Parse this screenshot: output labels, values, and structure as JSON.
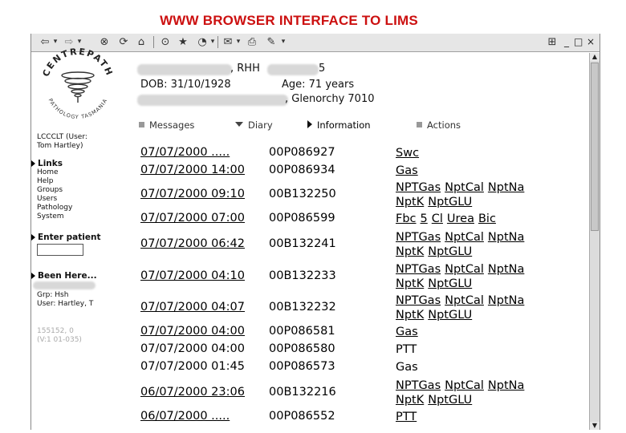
{
  "slide_title": "WWW BROWSER INTERFACE TO LIMS",
  "toolbar": {
    "icons": [
      "back-icon",
      "forward-icon",
      "stop-icon",
      "refresh-icon",
      "home-icon",
      "search-icon",
      "favorites-icon",
      "history-icon",
      "mail-icon",
      "print-icon",
      "edit-icon"
    ]
  },
  "window_controls": [
    "_",
    "□",
    "×"
  ],
  "sidebar": {
    "logo_text": "CENTREPATH",
    "logo_subtext": "PATHOLOGY TASMANIA",
    "user_line1": "LCCCLT (User:",
    "user_line2": "Tom Hartley)",
    "links_heading": "Links",
    "links": [
      "Home",
      "Help",
      "Groups",
      "Users",
      "Pathology",
      "System"
    ],
    "enter_patient_heading": "Enter patient",
    "been_here_heading": "Been Here...",
    "grp_line": "Grp: Hsh",
    "user_line": "User: Hartley, T",
    "footer_line1": "155152, 0",
    "footer_line2": "(V:1 01-035)"
  },
  "patient": {
    "name_suffix": ", RHH",
    "name_tail": "5",
    "dob": "DOB: 31/10/1928",
    "age": "Age: 71 years",
    "address_tail": ", Glenorchy 7010"
  },
  "tabs": [
    {
      "label": "Messages",
      "marker": "square"
    },
    {
      "label": "Diary",
      "marker": "down"
    },
    {
      "label": "Information",
      "marker": "right"
    },
    {
      "label": "Actions",
      "marker": "square"
    }
  ],
  "results": [
    {
      "datetime": "07/07/2000 .....",
      "accession": "00P086927",
      "tests": [
        "Swc"
      ]
    },
    {
      "datetime": "07/07/2000 14:00",
      "accession": "00P086934",
      "tests": [
        "Gas"
      ]
    },
    {
      "datetime": "07/07/2000 09:10",
      "accession": "00B132250",
      "tests": [
        "NPTGas",
        "NptCal",
        "NptNa",
        "NptK",
        "NptGLU"
      ]
    },
    {
      "datetime": "07/07/2000 07:00",
      "accession": "00P086599",
      "tests": [
        "Fbc",
        "5",
        "Cl",
        "Urea",
        "Bic"
      ]
    },
    {
      "datetime": "07/07/2000 06:42",
      "accession": "00B132241",
      "tests": [
        "NPTGas",
        "NptCal",
        "NptNa",
        "NptK",
        "NptGLU"
      ]
    },
    {
      "datetime": "07/07/2000 04:10",
      "accession": "00B132233",
      "tests": [
        "NPTGas",
        "NptCal",
        "NptNa",
        "NptK",
        "NptGLU"
      ]
    },
    {
      "datetime": "07/07/2000 04:07",
      "accession": "00B132232",
      "tests": [
        "NPTGas",
        "NptCal",
        "NptNa",
        "NptK",
        "NptGLU"
      ]
    },
    {
      "datetime": "07/07/2000 04:00",
      "accession": "00P086581",
      "tests": [
        "Gas"
      ]
    },
    {
      "datetime": "07/07/2000 04:00",
      "accession": "00P086580",
      "tests": [
        "PTT"
      ]
    },
    {
      "datetime": "07/07/2000 01:45",
      "accession": "00P086573",
      "tests": [
        "Gas"
      ]
    },
    {
      "datetime": "06/07/2000 23:06",
      "accession": "00B132216",
      "tests": [
        "NPTGas",
        "NptCal",
        "NptNa",
        "NptK",
        "NptGLU"
      ]
    },
    {
      "datetime": "06/07/2000 .....",
      "accession": "00P086552",
      "tests": [
        "PTT"
      ]
    }
  ]
}
